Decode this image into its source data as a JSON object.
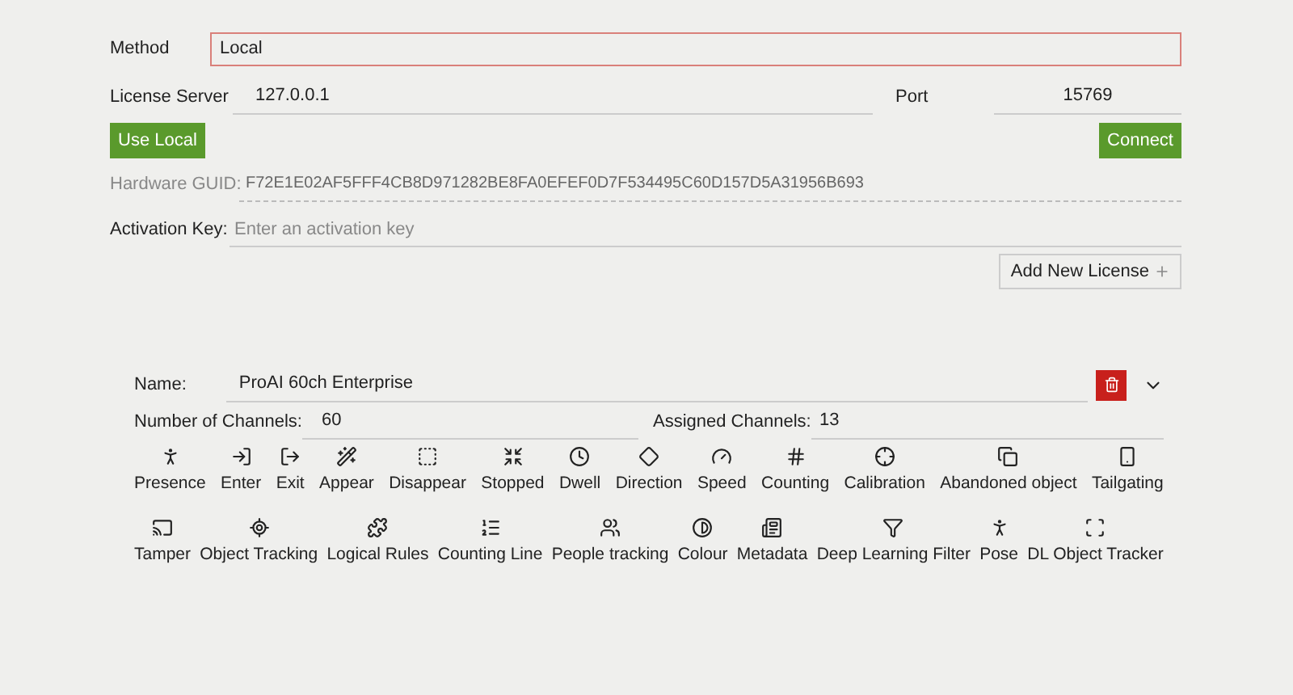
{
  "server": {
    "method": {
      "label": "Method",
      "value": "Local"
    },
    "license_server": {
      "label": "License Server",
      "value": "127.0.0.1"
    },
    "port": {
      "label": "Port",
      "value": "15769"
    },
    "use_local_button": "Use Local",
    "connect_button": "Connect",
    "hardware_guid": {
      "label": "Hardware GUID:",
      "value": "F72E1E02AF5FFF4CB8D971282BE8FA0EFEF0D7F534495C60D157D5A31956B693"
    },
    "activation_key": {
      "label": "Activation Key:",
      "placeholder": "Enter an activation key"
    },
    "add_license_button": "Add New License"
  },
  "license": {
    "name": {
      "label": "Name:",
      "value": "ProAI 60ch Enterprise"
    },
    "channels": {
      "label": "Number of Channels:",
      "value": "60"
    },
    "assigned": {
      "label": "Assigned Channels:",
      "value": "13"
    },
    "features": [
      {
        "label": "Presence"
      },
      {
        "label": "Enter"
      },
      {
        "label": "Exit"
      },
      {
        "label": "Appear"
      },
      {
        "label": "Disappear"
      },
      {
        "label": "Stopped"
      },
      {
        "label": "Dwell"
      },
      {
        "label": "Direction"
      },
      {
        "label": "Speed"
      },
      {
        "label": "Counting"
      },
      {
        "label": "Calibration"
      },
      {
        "label": "Abandoned object"
      },
      {
        "label": "Tailgating"
      },
      {
        "label": "Tamper"
      },
      {
        "label": "Object Tracking"
      },
      {
        "label": "Logical Rules"
      },
      {
        "label": "Counting Line"
      },
      {
        "label": "People tracking"
      },
      {
        "label": "Colour"
      },
      {
        "label": "Metadata"
      },
      {
        "label": "Deep Learning Filter"
      },
      {
        "label": "Pose"
      },
      {
        "label": "DL Object Tracker"
      }
    ]
  }
}
